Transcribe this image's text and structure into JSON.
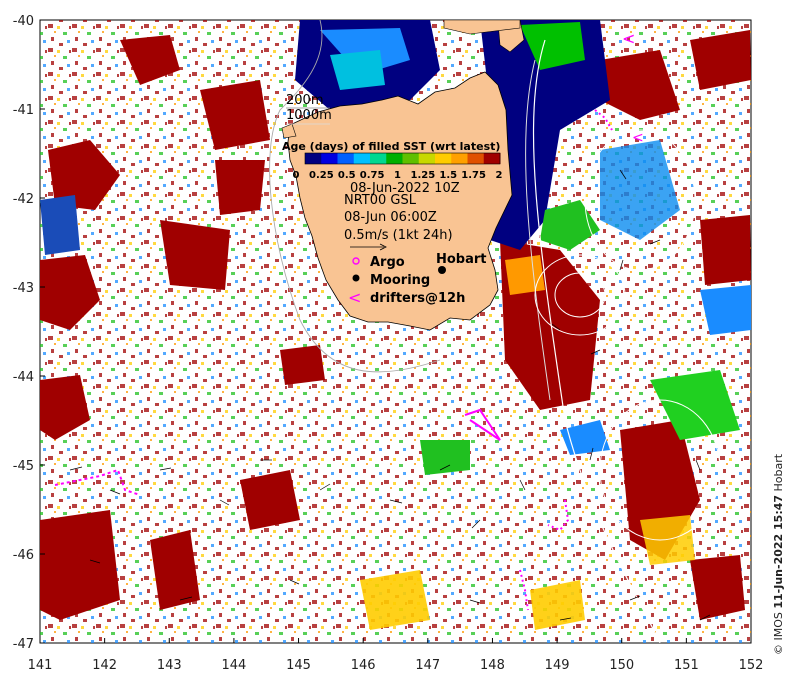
{
  "map": {
    "lon_ticks": [
      "141",
      "142",
      "143",
      "144",
      "145",
      "146",
      "147",
      "148",
      "149",
      "150",
      "151",
      "152"
    ],
    "lat_ticks": [
      "-40",
      "-41",
      "-42",
      "-43",
      "-44",
      "-45",
      "-46",
      "-47"
    ],
    "lon_range": [
      141,
      152
    ],
    "lat_range": [
      -47,
      -40
    ]
  },
  "bathymetry_legend": {
    "line1": "200m",
    "line2": "1000m"
  },
  "colorbar": {
    "title": "Age (days) of filled SST (wrt latest)",
    "tick_labels": [
      "0",
      "0.25",
      "0.5",
      "0.75",
      "1",
      "1.25",
      "1.5",
      "1.75",
      "2"
    ],
    "colors": [
      "#000080",
      "#0000e0",
      "#0060ff",
      "#00c0ff",
      "#00d890",
      "#00b000",
      "#60c000",
      "#c8d800",
      "#ffcc00",
      "#ffa000",
      "#e05000",
      "#a00000"
    ]
  },
  "timestamp": "08-Jun-2022 10Z",
  "current_info": {
    "source": "NRT00 GSL",
    "time": "08-Jun 06:00Z",
    "scale": "0.5m/s (1kt 24h)"
  },
  "symbols": {
    "argo": "Argo",
    "mooring": "Mooring",
    "drifters": "drifters@12h"
  },
  "place_label": "Hobart",
  "credit": {
    "org": "© IMOS",
    "date": "11-Jun-2022 15:47",
    "place": "Hobart"
  },
  "colors": {
    "land": "#f9c493",
    "deep_red": "#a00000",
    "green": "#20c020",
    "yellow": "#ffcc00",
    "navy": "#000080",
    "drifter": "#ff00ff"
  }
}
